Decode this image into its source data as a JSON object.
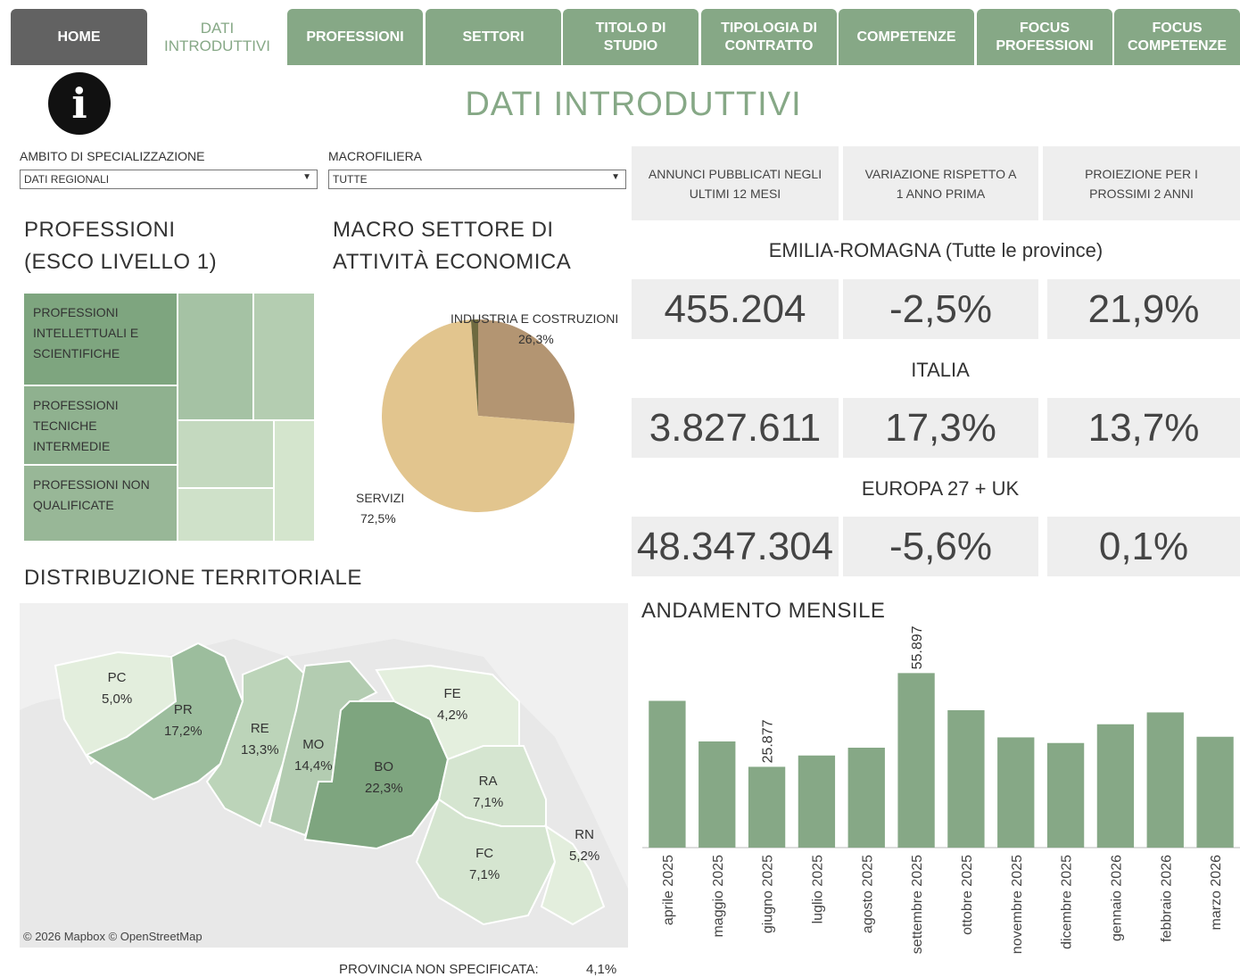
{
  "tabs": [
    {
      "label": "HOME"
    },
    {
      "label": "DATI\nINTRODUTTIVI"
    },
    {
      "label": "PROFESSIONI"
    },
    {
      "label": "SETTORI"
    },
    {
      "label": "TITOLO DI\nSTUDIO"
    },
    {
      "label": "TIPOLOGIA DI\nCONTRATTO"
    },
    {
      "label": "COMPETENZE"
    },
    {
      "label": "FOCUS\nPROFESSIONI"
    },
    {
      "label": "FOCUS\nCOMPETENZE"
    }
  ],
  "page_title": "DATI INTRODUTTIVI",
  "filters": {
    "ambito_label": "AMBITO DI SPECIALIZZAZIONE",
    "ambito_value": "DATI REGIONALI",
    "macrofiliera_label": "MACROFILIERA",
    "macrofiliera_value": "TUTTE"
  },
  "professioni": {
    "title": "PROFESSIONI\n(ESCO LIVELLO 1)",
    "labels": [
      "PROFESSIONI\nINTELLETTUALI E\nSCIENTIFICHE",
      "PROFESSIONI\nTECNICHE\nINTERMEDIE",
      "PROFESSIONI NON\nQUALIFICATE"
    ]
  },
  "macro_settore": {
    "title": "MACRO SETTORE DI\nATTIVITÀ ECONOMICA",
    "slices": [
      {
        "name": "INDUSTRIA E COSTRUZIONI",
        "pct_label": "26,3%",
        "value": 26.3,
        "color": "#b39572"
      },
      {
        "name": "SERVIZI",
        "pct_label": "72,5%",
        "value": 72.5,
        "color": "#e2c58e"
      },
      {
        "name": "",
        "pct_label": "",
        "value": 1.2,
        "color": "#6e6a40"
      }
    ]
  },
  "kpi": {
    "headers": [
      "ANNUNCI PUBBLICATI NEGLI\nULTIMI 12 MESI",
      "VARIAZIONE RISPETTO A\n1 ANNO PRIMA",
      "PROIEZIONE PER I\nPROSSIMI 2 ANNI"
    ],
    "rows": [
      {
        "region": "EMILIA-ROMAGNA (Tutte le province)",
        "values": [
          "455.204",
          "-2,5%",
          "21,9%"
        ]
      },
      {
        "region": "ITALIA",
        "values": [
          "3.827.611",
          "17,3%",
          "13,7%"
        ]
      },
      {
        "region": "EUROPA 27 + UK",
        "values": [
          "48.347.304",
          "-5,6%",
          "0,1%"
        ]
      }
    ]
  },
  "map": {
    "title": "DISTRIBUZIONE TERRITORIALE",
    "provinces": [
      {
        "code": "PC",
        "pct": "5,0%",
        "color": "#e3eedd"
      },
      {
        "code": "PR",
        "pct": "17,2%",
        "color": "#9cbd9d"
      },
      {
        "code": "RE",
        "pct": "13,3%",
        "color": "#bcd4b9"
      },
      {
        "code": "MO",
        "pct": "14,4%",
        "color": "#b3ccb1"
      },
      {
        "code": "BO",
        "pct": "22,3%",
        "color": "#7ea57f"
      },
      {
        "code": "FE",
        "pct": "4,2%",
        "color": "#e4efde"
      },
      {
        "code": "RA",
        "pct": "7,1%",
        "color": "#d5e5d0"
      },
      {
        "code": "FC",
        "pct": "7,1%",
        "color": "#d5e5d0"
      },
      {
        "code": "RN",
        "pct": "5,2%",
        "color": "#e3eedd"
      }
    ],
    "attribution": "© 2026 Mapbox  © OpenStreetMap",
    "unspecified_label": "PROVINCIA NON SPECIFICATA:",
    "unspecified_value": "4,1%"
  },
  "chart_data": {
    "type": "bar",
    "title": "ANDAMENTO MENSILE",
    "categories": [
      "aprile 2025",
      "maggio 2025",
      "giugno 2025",
      "luglio 2025",
      "agosto 2025",
      "settembre 2025",
      "ottobre 2025",
      "novembre 2025",
      "dicembre 2025",
      "gennaio 2026",
      "febbraio 2026",
      "marzo 2026"
    ],
    "values": [
      47000,
      34000,
      25877,
      29500,
      32000,
      55897,
      44000,
      35300,
      33500,
      39500,
      43300,
      35500
    ],
    "value_labels": [
      "",
      "",
      "25.877",
      "",
      "",
      "55.897",
      "",
      "",
      "",
      "",
      "",
      ""
    ],
    "color": "#86a886",
    "ylim": [
      0,
      60000
    ],
    "grid": false
  }
}
